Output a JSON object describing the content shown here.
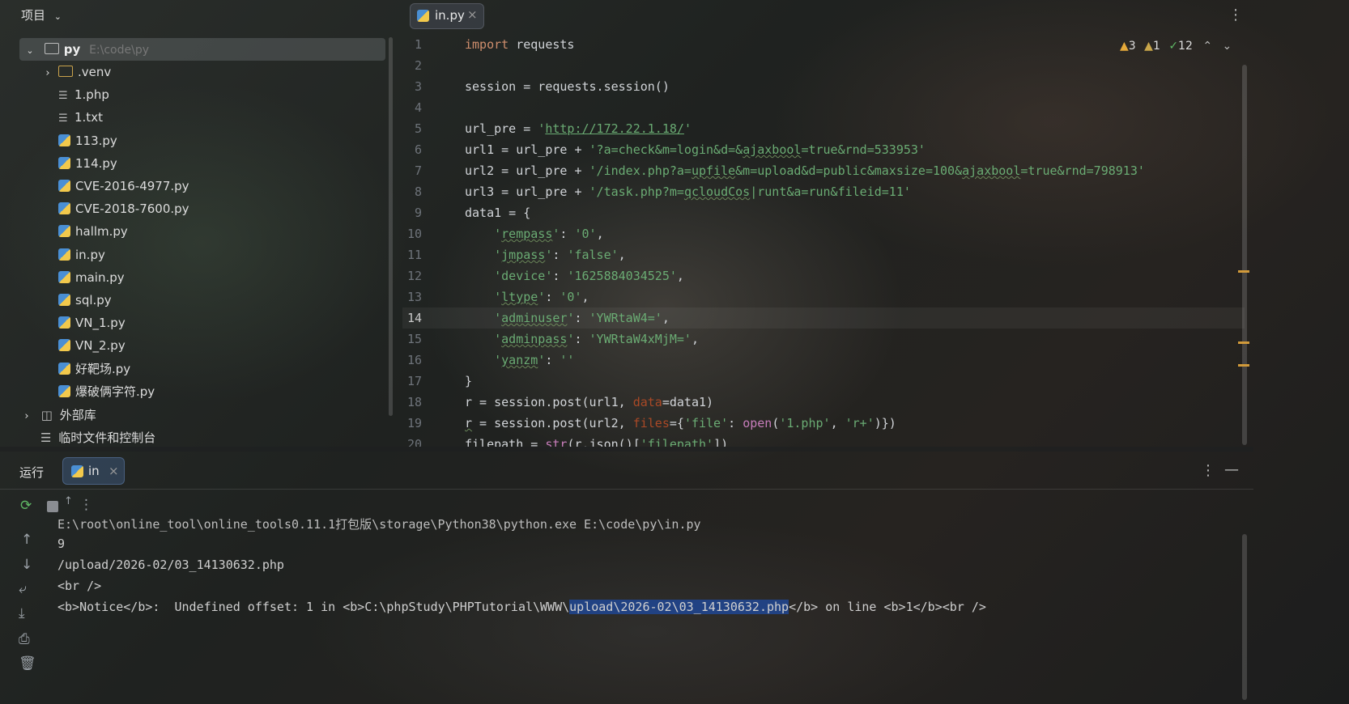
{
  "project": {
    "title": "项目",
    "root": {
      "name": "py",
      "path": "E:\\code\\py"
    },
    "items": [
      {
        "label": ".venv",
        "type": "folder"
      },
      {
        "label": "1.php",
        "type": "text"
      },
      {
        "label": "1.txt",
        "type": "text"
      },
      {
        "label": "113.py",
        "type": "python"
      },
      {
        "label": "114.py",
        "type": "python"
      },
      {
        "label": "CVE-2016-4977.py",
        "type": "python"
      },
      {
        "label": "CVE-2018-7600.py",
        "type": "python"
      },
      {
        "label": "hallm.py",
        "type": "python"
      },
      {
        "label": "in.py",
        "type": "python"
      },
      {
        "label": "main.py",
        "type": "python"
      },
      {
        "label": "sql.py",
        "type": "python"
      },
      {
        "label": "VN_1.py",
        "type": "python"
      },
      {
        "label": "VN_2.py",
        "type": "python"
      },
      {
        "label": "好靶场.py",
        "type": "python"
      },
      {
        "label": "爆破俩字符.py",
        "type": "python"
      }
    ],
    "external_libs": "外部库",
    "scratches": "临时文件和控制台"
  },
  "editor": {
    "tab_label": "in.py",
    "inspections": {
      "warnings": "3",
      "weak_warnings": "1",
      "typos": "12"
    },
    "current_line": 14,
    "line_numbers": [
      "1",
      "2",
      "3",
      "4",
      "5",
      "6",
      "7",
      "8",
      "9",
      "10",
      "11",
      "12",
      "13",
      "14",
      "15",
      "16",
      "17",
      "18",
      "19",
      "20"
    ]
  },
  "run": {
    "title": "运行",
    "tab_label": "in",
    "output": [
      "E:\\root\\online_tool\\online_tools0.11.1打包版\\storage\\Python38\\python.exe E:\\code\\py\\in.py",
      "9",
      "/upload/2026-02/03_14130632.php",
      "<br />"
    ],
    "notice_prefix": "<b>Notice</b>:  Undefined offset: 1 in <b>C:\\phpStudy\\PHPTutorial\\WWW\\",
    "notice_selected": "upload\\2026-02\\03_14130632.php",
    "notice_suffix": "</b> on line <b>1</b><br />"
  },
  "colors": {
    "keyword": "#cf8e6d",
    "string": "#6aab73",
    "selection": "#214283",
    "kwarg": "#aa4926"
  }
}
